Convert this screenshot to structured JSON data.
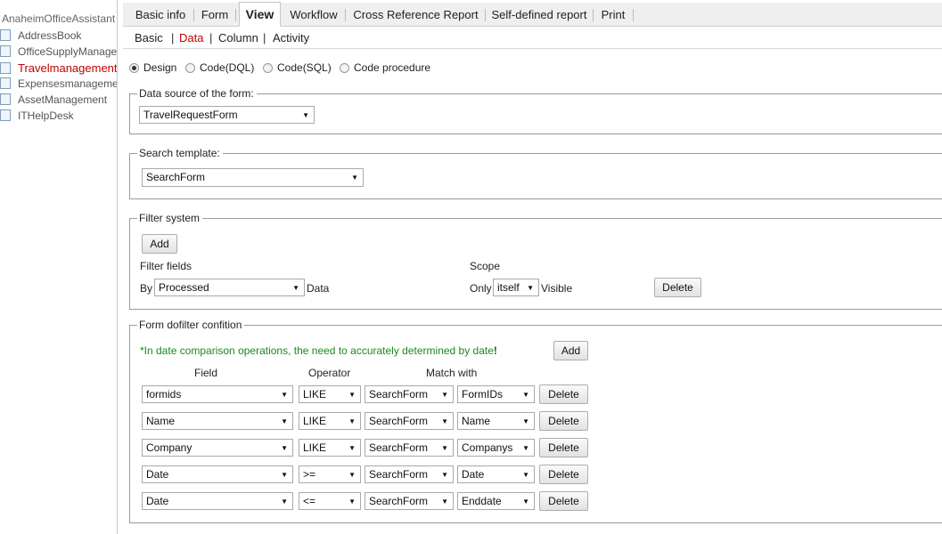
{
  "sidebar": {
    "root": "AnaheimOfficeAssistant",
    "items": [
      {
        "label": "AddressBook"
      },
      {
        "label": "OfficeSupplyManagement"
      },
      {
        "label": "Travelmanagement"
      },
      {
        "label": "Expensesmanagement"
      },
      {
        "label": "AssetManagement"
      },
      {
        "label": "ITHelpDesk"
      }
    ]
  },
  "tabs": [
    "Basic info",
    "Form",
    "View",
    "Workflow",
    "Cross Reference Report",
    "Self-defined report",
    "Print"
  ],
  "subtabs": [
    "Basic",
    "Data",
    "Column",
    "Activity"
  ],
  "modes": [
    "Design",
    "Code(DQL)",
    "Code(SQL)",
    "Code procedure"
  ],
  "data_source": {
    "legend": "Data source of the form:",
    "value": "TravelRequestForm"
  },
  "search_template": {
    "legend": "Search template:",
    "value": "SearchForm"
  },
  "filter_system": {
    "legend": "Filter system",
    "add_label": "Add",
    "filter_fields_label": "Filter fields",
    "scope_label": "Scope",
    "by_label": "By",
    "field_value": "Processed",
    "data_label": "Data",
    "only_label": "Only",
    "scope_value": "itself",
    "visible_label": "Visible",
    "delete_label": "Delete"
  },
  "dofilter": {
    "legend": "Form dofilter confition",
    "note": "*In date comparison operations, the need to accurately determined by date",
    "note_mark": "!",
    "add_label": "Add",
    "col_field": "Field",
    "col_operator": "Operator",
    "col_match": "Match with",
    "rows": [
      {
        "field": "formids",
        "operator": "LIKE",
        "source": "SearchForm",
        "target": "FormIDs",
        "delete": "Delete"
      },
      {
        "field": "Name",
        "operator": "LIKE",
        "source": "SearchForm",
        "target": "Name",
        "delete": "Delete"
      },
      {
        "field": "Company",
        "operator": "LIKE",
        "source": "SearchForm",
        "target": "Companys",
        "delete": "Delete"
      },
      {
        "field": "Date",
        "operator": ">=",
        "source": "SearchForm",
        "target": "Date",
        "delete": "Delete"
      },
      {
        "field": "Date",
        "operator": "<=",
        "source": "SearchForm",
        "target": "Enddate",
        "delete": "Delete"
      }
    ]
  }
}
